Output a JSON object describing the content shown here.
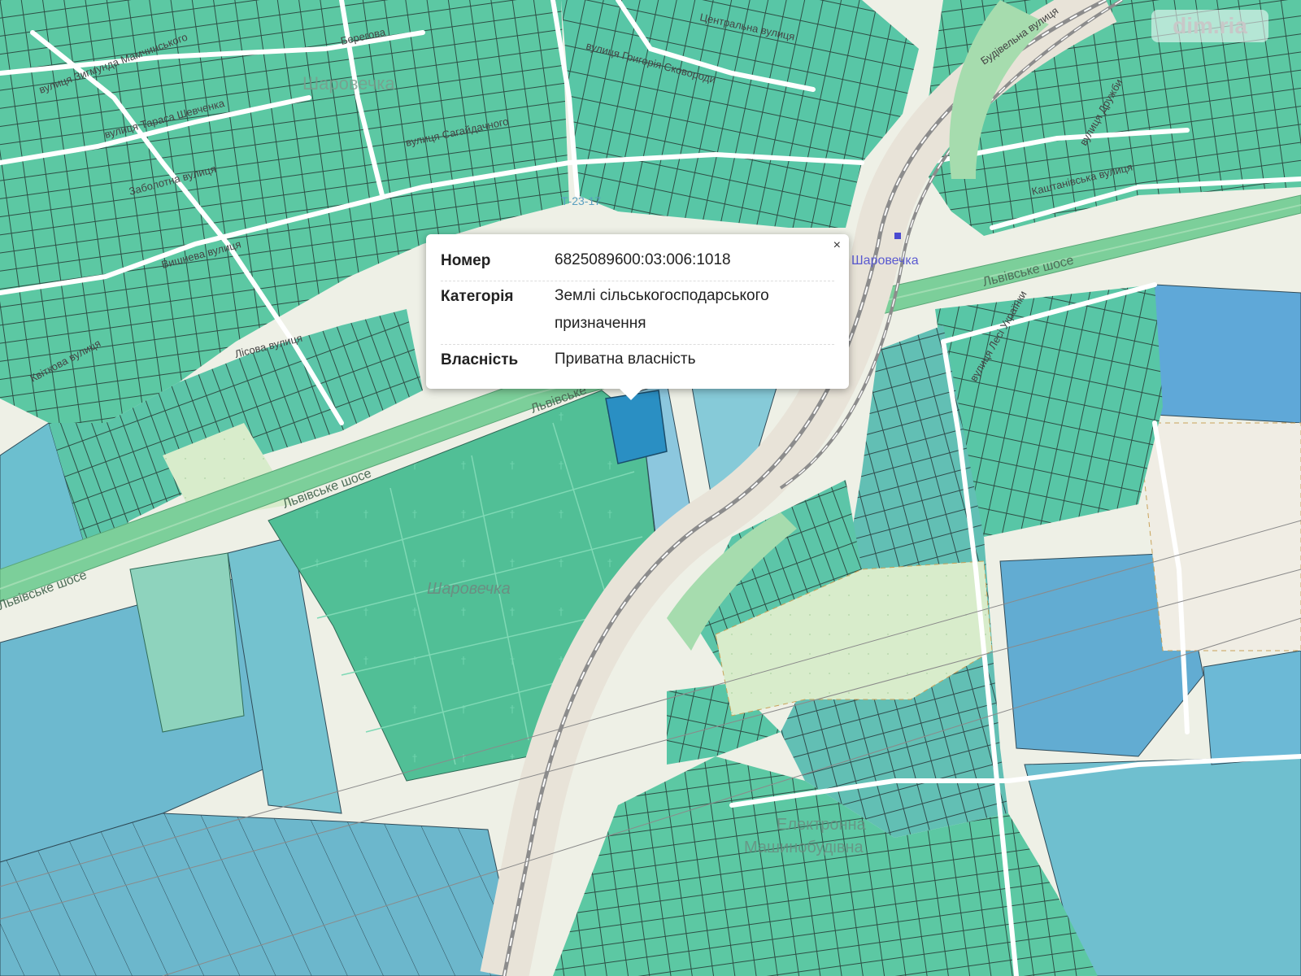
{
  "map": {
    "labels": {
      "village_top": "Шаровечка",
      "cemetery": "Шаровечка",
      "station": "Шаровечка",
      "highway_left1": "Львівське шосе",
      "highway_left2": "Львівське шосе",
      "highway_right": "Львівське шосе",
      "highway_mid": "Львівське",
      "st_zygmunda": "вулиця Зигмунда Мамчинського",
      "st_shevchenka": "вулиця Тараса Шевченка",
      "st_zabolotna": "Заболотна вулиця",
      "st_vyshneva": "Вишнева вулиця",
      "st_kvitkova": "Квіткова вулиця",
      "st_lisova": "Лісова вулиця",
      "st_grygoriya": "вулиця Григорія Сковороди",
      "st_sahaydachnogo": "вулиця Сагайдачного",
      "st_central": "Центральна вулиця",
      "st_berehova": "Берегова",
      "st_budivelna": "Будівельна вулиця",
      "st_kyivska": "Каштанівська вулиця",
      "st_druzhby": "вулиця Дружби",
      "st_ukrainky": "вулиця Лесі Українки",
      "st_elektronna": "Електронна",
      "st_zhyttya": "Машинобудівна",
      "road_code": "Т-23-17"
    },
    "icons": [
      "station-marker-icon"
    ]
  },
  "popup": {
    "close_label": "×",
    "rows": [
      {
        "key": "Номер",
        "value": "6825089600:03:006:1018"
      },
      {
        "key": "Категорія",
        "value": "Землі сільськогосподарського призначення"
      },
      {
        "key": "Власність",
        "value": "Приватна власність"
      }
    ]
  },
  "watermark": "dim.ria",
  "colors": {
    "parcel_green": "#5cc8a3",
    "parcel_teal": "#6fbfb6",
    "parcel_blue": "#5fa8cf",
    "cemetery": "#51bf96",
    "highway": "#7ccf9a",
    "selected": "#2a8fc3"
  }
}
